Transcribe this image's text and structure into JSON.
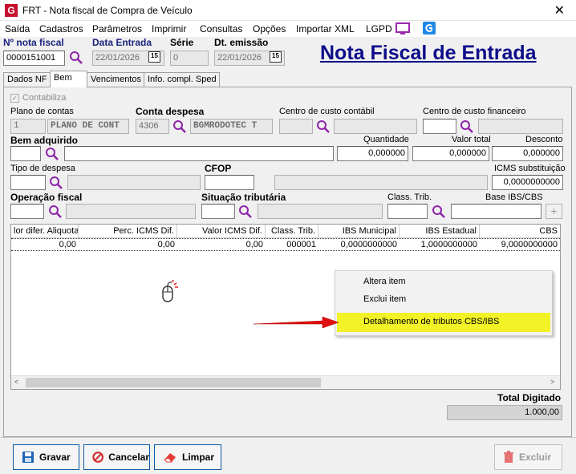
{
  "window": {
    "title": "FRT - Nota fiscal de Compra de Veículo",
    "close_glyph": "✕",
    "app_icon_letter": "G"
  },
  "menu": [
    "Saída",
    "Cadastros",
    "Parâmetros",
    "Imprimir",
    "Consultas",
    "Opções",
    "Importar XML",
    "LGPD"
  ],
  "header": {
    "nota_fiscal_label": "Nº nota fiscal",
    "nota_fiscal_value": "0000151001",
    "data_entrada_label": "Data Entrada",
    "data_entrada_value": "22/01/2026",
    "serie_label": "Série",
    "serie_value": "0",
    "dt_emissao_label": "Dt. emissão",
    "dt_emissao_value": "22/01/2026",
    "calendar_glyph": "15",
    "page_title": "Nota Fiscal de Entrada"
  },
  "tabs": [
    "Dados NF",
    "Bem",
    "Vencimentos",
    "Info. compl. Sped"
  ],
  "form": {
    "contabiliza_label": "Contabiliza",
    "plano_contas_label": "Plano de contas",
    "plano_contas_code": "1",
    "plano_contas_name": "PLANO DE CONT",
    "conta_despesa_label": "Conta despesa",
    "conta_despesa_code": "4306",
    "conta_despesa_name": "BGMRODOTEC T",
    "centro_contabil_label": "Centro de custo contábil",
    "centro_financeiro_label": "Centro de custo financeiro",
    "bem_label": "Bem adquirido",
    "quantidade_label": "Quantidade",
    "quantidade_value": "0,000000",
    "valor_total_label": "Valor total",
    "valor_total_value": "0,000000",
    "desconto_label": "Desconto",
    "desconto_value": "0,000000",
    "tipo_despesa_label": "Tipo de despesa",
    "cfop_label": "CFOP",
    "icms_subst_label": "ICMS substituição",
    "icms_subst_value": "0,0000000000",
    "operacao_label": "Operação fiscal",
    "situacao_label": "Situação tributária",
    "class_trib_label": "Class. Trib.",
    "base_ibs_label": "Base IBS/CBS",
    "plus_glyph": "+"
  },
  "grid": {
    "headers": [
      "lor difer. Aliquota",
      "Perc. ICMS Dif.",
      "Valor ICMS Dif.",
      "Class. Trib.",
      "IBS Municipal",
      "IBS Estadual",
      "CBS"
    ],
    "rows": [
      [
        "0,00",
        "0,00",
        "0,00",
        "000001",
        "0,0000000000",
        "1,0000000000",
        "9,0000000000"
      ]
    ]
  },
  "context_menu": {
    "items": [
      "Altera item",
      "Exclui item",
      "Detalhamento de tributos CBS/IBS"
    ],
    "highlight_color": "#f2f227"
  },
  "totals": {
    "label": "Total Digitado",
    "value": "1.000,00"
  },
  "buttons": {
    "gravar": "Gravar",
    "cancelar": "Cancelar",
    "limpar": "Limpar",
    "excluir": "Excluir"
  },
  "colors": {
    "accent": "#0d0d8a",
    "magnifier": "#8e24aa",
    "arrow": "#e01010"
  }
}
